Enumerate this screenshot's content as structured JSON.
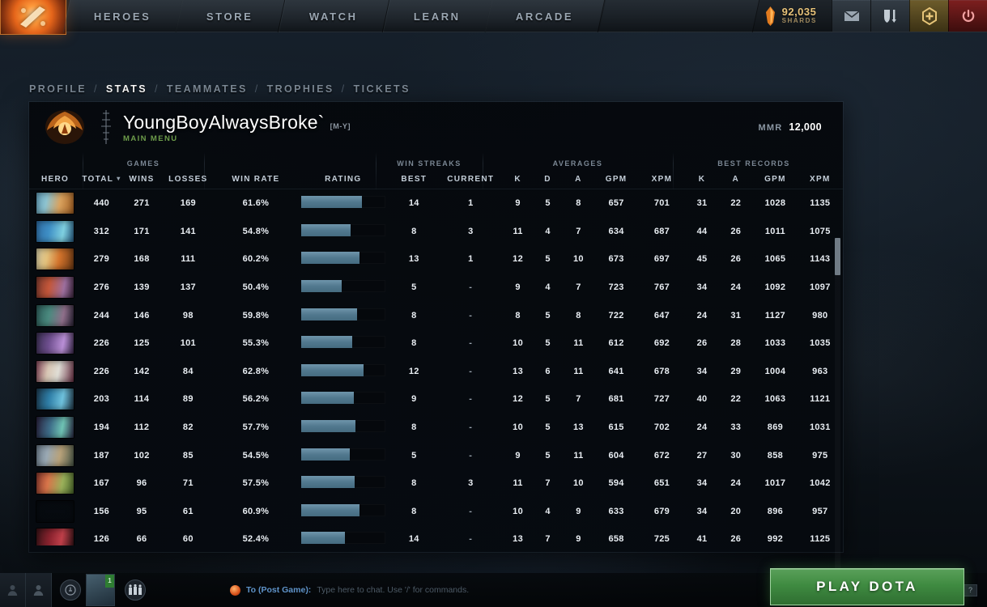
{
  "topnav": {
    "logo_icon": "dota-logo-icon",
    "items": [
      {
        "label": "HEROES",
        "name": "nav-heroes"
      },
      {
        "label": "STORE",
        "name": "nav-store"
      },
      {
        "label": "WATCH",
        "name": "nav-watch"
      },
      {
        "label": "LEARN",
        "name": "nav-learn"
      },
      {
        "label": "ARCADE",
        "name": "nav-arcade"
      }
    ],
    "currency": {
      "amount": "92,035",
      "label": "SHARDS",
      "icon": "shard-icon"
    },
    "buttons": [
      {
        "name": "mail-icon"
      },
      {
        "name": "armory-icon"
      },
      {
        "name": "plus-hex-icon"
      },
      {
        "name": "power-icon"
      }
    ]
  },
  "breadcrumb": {
    "items": [
      {
        "label": "PROFILE",
        "active": false
      },
      {
        "label": "STATS",
        "active": true
      },
      {
        "label": "TEAMMATES",
        "active": false
      },
      {
        "label": "TROPHIES",
        "active": false
      },
      {
        "label": "TICKETS",
        "active": false
      }
    ],
    "separator": "/"
  },
  "player": {
    "name": "YoungBoyAlwaysBroke`",
    "tag": "[M-Y]",
    "status": "MAIN MENU",
    "mmr_label": "MMR",
    "mmr_value": "12,000"
  },
  "table": {
    "groups": [
      {
        "label": "",
        "span": 1
      },
      {
        "label": "GAMES",
        "span": 3
      },
      {
        "label": "",
        "span": 2
      },
      {
        "label": "WIN STREAKS",
        "span": 2
      },
      {
        "label": "AVERAGES",
        "span": 5
      },
      {
        "label": "BEST RECORDS",
        "span": 4
      }
    ],
    "columns": [
      "HERO",
      "TOTAL",
      "WINS",
      "LOSSES",
      "WIN RATE",
      "RATING",
      "BEST",
      "CURRENT",
      "K",
      "D",
      "A",
      "GPM",
      "XPM",
      "K",
      "A",
      "GPM",
      "XPM"
    ],
    "sorted_column": "TOTAL",
    "sort_icon": "chevron-down-icon",
    "rows": [
      {
        "portrait": "linear-gradient(100deg,#6aa8c4 0%,#8ec3cf 28%,#d9a25e 62%,#a35f22 100%)",
        "total": "440",
        "wins": "271",
        "losses": "169",
        "win_rate": "61.6%",
        "rating_pct": 72,
        "best": "14",
        "current": "1",
        "avg_k": "9",
        "avg_d": "5",
        "avg_a": "8",
        "avg_gpm": "657",
        "avg_xpm": "701",
        "rec_k": "31",
        "rec_a": "22",
        "rec_gpm": "1028",
        "rec_xpm": "1135"
      },
      {
        "portrait": "linear-gradient(100deg,#2f6fa8 0%,#3f90c6 35%,#7fd0e0 70%,#2a5f86 100%)",
        "total": "312",
        "wins": "171",
        "losses": "141",
        "win_rate": "54.8%",
        "rating_pct": 59,
        "best": "8",
        "current": "3",
        "avg_k": "11",
        "avg_d": "4",
        "avg_a": "7",
        "avg_gpm": "634",
        "avg_xpm": "687",
        "rec_k": "44",
        "rec_a": "26",
        "rec_gpm": "1011",
        "rec_xpm": "1075"
      },
      {
        "portrait": "linear-gradient(100deg,#d9cfa6 0%,#e3c07a 30%,#d4742c 60%,#6e3a14 100%)",
        "total": "279",
        "wins": "168",
        "losses": "111",
        "win_rate": "60.2%",
        "rating_pct": 69,
        "best": "13",
        "current": "1",
        "avg_k": "12",
        "avg_d": "5",
        "avg_a": "10",
        "avg_gpm": "673",
        "avg_xpm": "697",
        "rec_k": "45",
        "rec_a": "26",
        "rec_gpm": "1065",
        "rec_xpm": "1143"
      },
      {
        "portrait": "linear-gradient(100deg,#7e3a2e 0%,#c4573a 35%,#9d6f9e 72%,#3e2740 100%)",
        "total": "276",
        "wins": "139",
        "losses": "137",
        "win_rate": "50.4%",
        "rating_pct": 48,
        "best": "5",
        "current": "-",
        "avg_k": "9",
        "avg_d": "4",
        "avg_a": "7",
        "avg_gpm": "723",
        "avg_xpm": "767",
        "rec_k": "34",
        "rec_a": "24",
        "rec_gpm": "1092",
        "rec_xpm": "1097"
      },
      {
        "portrait": "linear-gradient(100deg,#2d5d5a 0%,#4b8a7f 35%,#8f6f8a 70%,#2b2437 100%)",
        "total": "244",
        "wins": "146",
        "losses": "98",
        "win_rate": "59.8%",
        "rating_pct": 67,
        "best": "8",
        "current": "-",
        "avg_k": "8",
        "avg_d": "5",
        "avg_a": "8",
        "avg_gpm": "722",
        "avg_xpm": "647",
        "rec_k": "24",
        "rec_a": "31",
        "rec_gpm": "1127",
        "rec_xpm": "980"
      },
      {
        "portrait": "linear-gradient(100deg,#3a2f52 0%,#6f4f8f 35%,#b98fd6 70%,#3c2b4e 100%)",
        "total": "226",
        "wins": "125",
        "losses": "101",
        "win_rate": "55.3%",
        "rating_pct": 61,
        "best": "8",
        "current": "-",
        "avg_k": "10",
        "avg_d": "5",
        "avg_a": "11",
        "avg_gpm": "612",
        "avg_xpm": "692",
        "rec_k": "26",
        "rec_a": "28",
        "rec_gpm": "1033",
        "rec_xpm": "1035"
      },
      {
        "portrait": "linear-gradient(100deg,#8a4a5e 0%,#d8c6b4 32%,#e0ded6 58%,#6b3246 100%)",
        "total": "226",
        "wins": "142",
        "losses": "84",
        "win_rate": "62.8%",
        "rating_pct": 74,
        "best": "12",
        "current": "-",
        "avg_k": "13",
        "avg_d": "6",
        "avg_a": "11",
        "avg_gpm": "641",
        "avg_xpm": "678",
        "rec_k": "34",
        "rec_a": "29",
        "rec_gpm": "1004",
        "rec_xpm": "963"
      },
      {
        "portrait": "linear-gradient(100deg,#1d3c52 0%,#2f7fa8 35%,#6fc2dd 68%,#20394a 100%)",
        "total": "203",
        "wins": "114",
        "losses": "89",
        "win_rate": "56.2%",
        "rating_pct": 63,
        "best": "9",
        "current": "-",
        "avg_k": "12",
        "avg_d": "5",
        "avg_a": "7",
        "avg_gpm": "681",
        "avg_xpm": "727",
        "rec_k": "40",
        "rec_a": "22",
        "rec_gpm": "1063",
        "rec_xpm": "1121"
      },
      {
        "portrait": "linear-gradient(100deg,#2b2340 0%,#3f6f8a 38%,#6fc3b4 68%,#2a2a46 100%)",
        "total": "194",
        "wins": "112",
        "losses": "82",
        "win_rate": "57.7%",
        "rating_pct": 65,
        "best": "8",
        "current": "-",
        "avg_k": "10",
        "avg_d": "5",
        "avg_a": "13",
        "avg_gpm": "615",
        "avg_xpm": "702",
        "rec_k": "24",
        "rec_a": "33",
        "rec_gpm": "869",
        "rec_xpm": "1031"
      },
      {
        "portrait": "linear-gradient(100deg,#6f7f8e 0%,#9aa9b4 30%,#b8a27a 62%,#4c5a4a 100%)",
        "total": "187",
        "wins": "102",
        "losses": "85",
        "win_rate": "54.5%",
        "rating_pct": 58,
        "best": "5",
        "current": "-",
        "avg_k": "9",
        "avg_d": "5",
        "avg_a": "11",
        "avg_gpm": "604",
        "avg_xpm": "672",
        "rec_k": "27",
        "rec_a": "30",
        "rec_gpm": "858",
        "rec_xpm": "975"
      },
      {
        "portrait": "linear-gradient(100deg,#8e3a2e 0%,#d8754a 32%,#9ab05a 68%,#4c6a2c 100%)",
        "total": "167",
        "wins": "96",
        "losses": "71",
        "win_rate": "57.5%",
        "rating_pct": 64,
        "best": "8",
        "current": "3",
        "avg_k": "11",
        "avg_d": "7",
        "avg_a": "10",
        "avg_gpm": "594",
        "avg_xpm": "651",
        "rec_k": "34",
        "rec_a": "24",
        "rec_gpm": "1017",
        "rec_xpm": "1042"
      },
      {
        "portrait": "linear-gradient(100deg,#8c5a24 0%,#d9a košt 0%,#d9a85c 35%,#c98a3a 65%,#5c3410 100%)",
        "total": "156",
        "wins": "95",
        "losses": "61",
        "win_rate": "60.9%",
        "rating_pct": 69,
        "best": "8",
        "current": "-",
        "avg_k": "10",
        "avg_d": "4",
        "avg_a": "9",
        "avg_gpm": "633",
        "avg_xpm": "679",
        "rec_k": "34",
        "rec_a": "20",
        "rec_gpm": "896",
        "rec_xpm": "957"
      },
      {
        "portrait": "linear-gradient(100deg,#3a1418 0%,#8e2430 38%,#c0404a 66%,#2e1014 100%)",
        "total": "126",
        "wins": "66",
        "losses": "60",
        "win_rate": "52.4%",
        "rating_pct": 52,
        "best": "14",
        "current": "-",
        "avg_k": "13",
        "avg_d": "7",
        "avg_a": "9",
        "avg_gpm": "658",
        "avg_xpm": "725",
        "rec_k": "41",
        "rec_a": "26",
        "rec_gpm": "992",
        "rec_xpm": "1125"
      }
    ]
  },
  "bottombar": {
    "chat_to": "To (Post Game):",
    "chat_placeholder": "Type here to chat. Use '/' for commands.",
    "level_badge": "1",
    "icons": [
      {
        "name": "emoticon-icon",
        "glyph": "☺"
      },
      {
        "name": "reply-icon",
        "glyph": "↩"
      },
      {
        "name": "help-icon",
        "glyph": "?"
      }
    ],
    "play_label": "PLAY DOTA"
  },
  "colors": {
    "accent_orange": "#e4641a",
    "bar_blue": "#52798f",
    "play_green": "#3f8b41",
    "shard_gold": "#e8c37a"
  }
}
